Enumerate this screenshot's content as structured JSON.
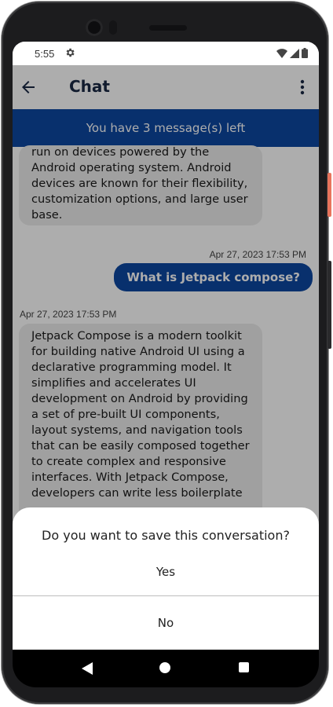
{
  "status_bar": {
    "time": "5:55"
  },
  "app_bar": {
    "title": "Chat"
  },
  "banner": {
    "text": "You have 3 message(s) left"
  },
  "messages": [
    {
      "sender": "bot",
      "lines": [
        "run on devices powered by the",
        "Android operating system. Android",
        "devices are known for their flexibility,",
        "customization options, and large user",
        "base."
      ]
    },
    {
      "sender": "user",
      "timestamp": "Apr 27, 2023 17:53 PM",
      "text": "What is Jetpack compose?"
    },
    {
      "sender": "bot",
      "timestamp": "Apr 27, 2023 17:53 PM",
      "lines": [
        "Jetpack Compose is a modern toolkit",
        "for building native Android UI using a",
        "declarative programming model. It",
        "simplifies and accelerates UI",
        "development on Android by providing",
        "a set of pre-built UI components,",
        "layout systems, and navigation tools",
        "that can be easily composed together",
        "to create complex and responsive",
        "interfaces. With Jetpack Compose,",
        "developers can write less boilerplate"
      ]
    }
  ],
  "dialog": {
    "title": "Do you want to save this conversation?",
    "yes_label": "Yes",
    "no_label": "No"
  },
  "icons": {
    "status_left": "gear-icon",
    "status_right": [
      "wifi-icon",
      "signal-icon",
      "battery-icon"
    ],
    "app_bar": [
      "back-arrow-icon",
      "more-vert-icon"
    ],
    "nav": [
      "nav-back-icon",
      "nav-home-icon",
      "nav-recents-icon"
    ]
  },
  "colors": {
    "primary": "#0d47a1",
    "title": "#1a2845",
    "bubble_bot": "#ececec"
  }
}
